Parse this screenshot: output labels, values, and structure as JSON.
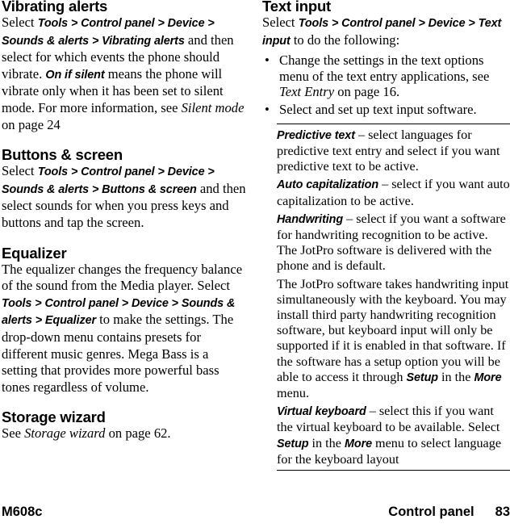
{
  "document": {
    "footer": {
      "model": "M608c",
      "chapter": "Control panel",
      "page_number": "83"
    }
  },
  "left_column": {
    "sections": [
      {
        "heading": "Vibrating alerts",
        "paragraph_parts": {
          "p1": "Select ",
          "p2": "Tools > Control panel > Device > Sounds & alerts > Vibrating alerts",
          "p3": " and then select for which events the phone should vibrate. ",
          "p4": "On if silent",
          "p5": " means the phone will vibrate only when it has been set to silent mode. For more information, see ",
          "p6": "Silent mode",
          "p7": " on page 24"
        }
      },
      {
        "heading": "Buttons & screen",
        "paragraph_parts": {
          "p1": "Select ",
          "p2": "Tools > Control panel > Device > Sounds & alerts > Buttons & screen",
          "p3": " and then select sounds for when you press keys and buttons and tap the screen."
        }
      },
      {
        "heading": "Equalizer",
        "paragraph_parts": {
          "p1": "The equalizer changes the frequency balance of the sound from the Media player. Select ",
          "p2": "Tools > Control panel > Device > Sounds & alerts > Equalizer",
          "p3": " to make the settings. The drop-down menu contains presets for different music genres. Mega Bass is a setting that provides more powerful bass tones regardless of volume."
        }
      },
      {
        "heading": "Storage wizard",
        "paragraph_parts": {
          "p1": "See ",
          "p2": "Storage wizard",
          "p3": " on page 62."
        }
      }
    ]
  },
  "right_column": {
    "heading": "Text input",
    "intro": {
      "p1": "Select ",
      "p2": "Tools > Control panel > Device > Text input",
      "p3": " to do the following:"
    },
    "bullets": [
      {
        "b1": "Change the settings in the text options menu of the text entry applications, see ",
        "b2": "Text Entry",
        "b3": " on page 16."
      },
      {
        "b1": "Select and set up text input software.",
        "b2": "",
        "b3": ""
      }
    ],
    "definitions": [
      {
        "term": "Predictive text",
        "dash": " – ",
        "body": "select languages for predictive text entry and select if you want predictive text to be active."
      },
      {
        "term": "Auto capitalization",
        "dash": " – ",
        "body": "select if you want auto capitalization to be active."
      },
      {
        "term": "Handwriting",
        "dash": " – ",
        "body": "select if you want a software for handwriting recognition to be active. The JotPro software is delivered with the phone and is default."
      }
    ],
    "jotpro_paragraph": {
      "t1": "The JotPro software takes handwriting input simultaneously with the keyboard. You may install third party handwriting recognition software, but keyboard input will only be supported if it is enabled in that software. If the software has a setup option you will be able to access it through ",
      "t2": "Setup",
      "t3": " in the ",
      "t4": "More",
      "t5": " menu."
    },
    "virtual_keyboard": {
      "term": "Virtual keyboard",
      "dash": " – ",
      "b1": "select this if you want the virtual keyboard to be available. Select ",
      "b2": "Setup",
      "b3": " in the ",
      "b4": "More",
      "b5": " menu to select language for the keyboard layout"
    }
  }
}
